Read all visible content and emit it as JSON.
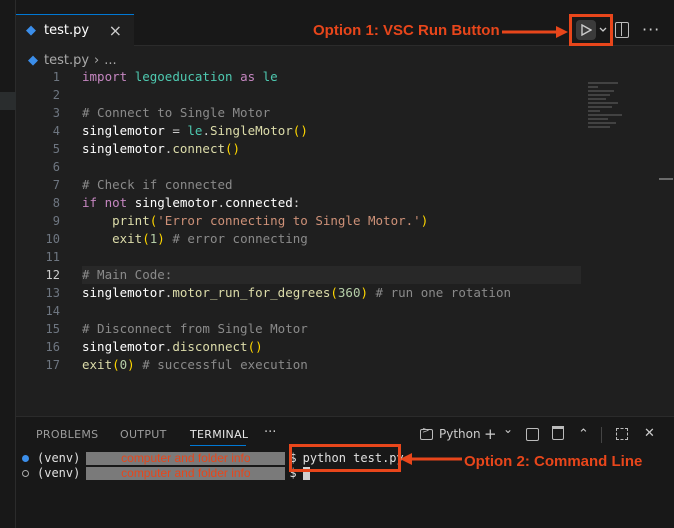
{
  "tab": {
    "filename": "test.py",
    "close": "×"
  },
  "breadcrumb": {
    "file": "test.py",
    "separator": "›",
    "more": "..."
  },
  "annotations": {
    "run_button": "Option 1: VSC Run Button",
    "command_line": "Option 2: Command Line"
  },
  "editor": {
    "current_line": 12,
    "lines": [
      "import legoeducation as le",
      "",
      "# Connect to Single Motor",
      "singlemotor = le.SingleMotor()",
      "singlemotor.connect()",
      "",
      "# Check if connected",
      "if not singlemotor.connected:",
      "    print('Error connecting to Single Motor.')",
      "    exit(1) # error connecting",
      "",
      "# Main Code:",
      "singlemotor.motor_run_for_degrees(360) # run one rotation",
      "",
      "# Disconnect from Single Motor",
      "singlemotor.disconnect()",
      "exit(0) # successful execution"
    ]
  },
  "panel": {
    "tabs": [
      "PROBLEMS",
      "OUTPUT",
      "TERMINAL"
    ],
    "active_tab": "TERMINAL",
    "more": "···",
    "shell": "Python",
    "add": "+",
    "chevron": "⌄",
    "close": "✕"
  },
  "terminal": {
    "prompt_env": "(venv)",
    "redacted_label": "computer and folder info",
    "prompt_symbol": "$",
    "command": "python test.py"
  },
  "colors": {
    "accent_annotation": "#e8461b",
    "editor_bg": "#1f1f1f",
    "tab_accent": "#0078d4"
  },
  "icons": [
    "python-file-icon",
    "close-icon",
    "play-icon",
    "chevron-down-icon",
    "split-editor-icon",
    "more-icon",
    "terminal-icon",
    "trash-icon",
    "maximize-icon"
  ]
}
